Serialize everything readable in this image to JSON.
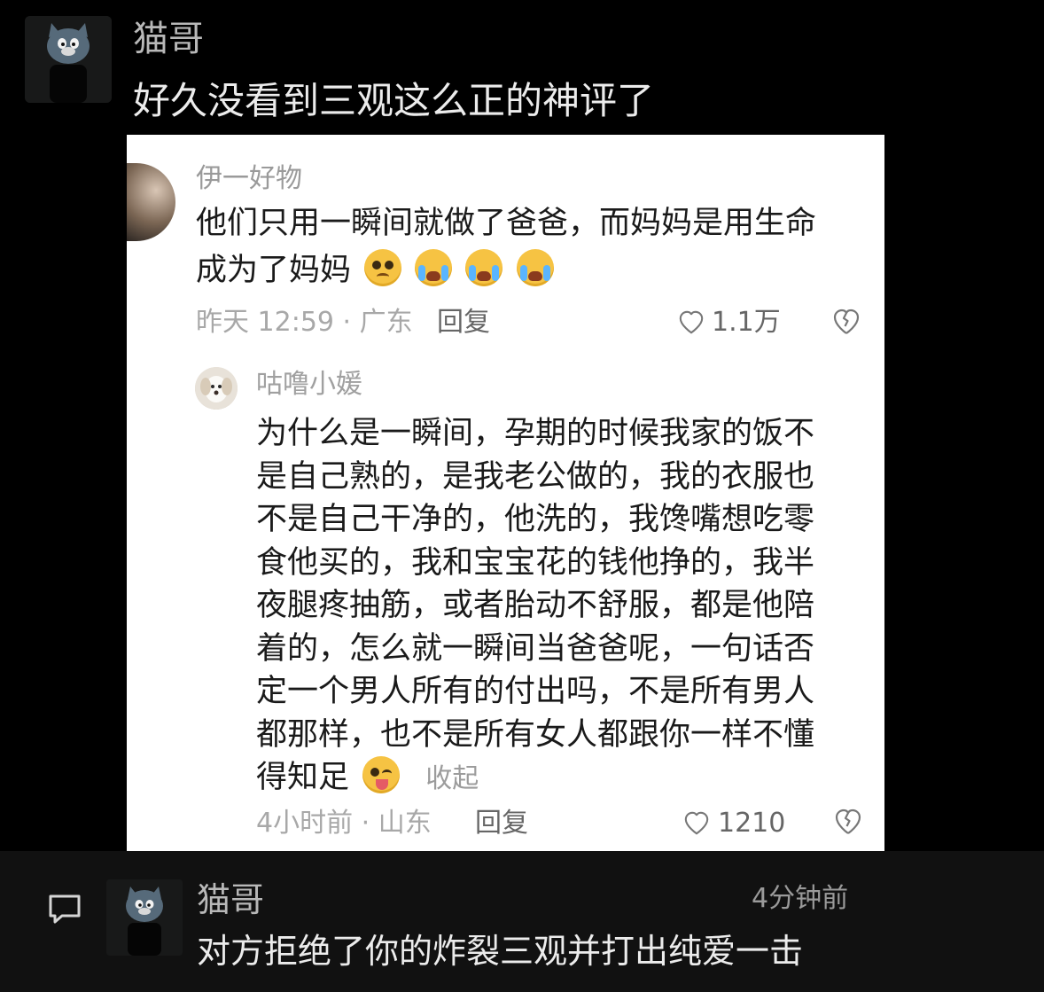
{
  "top_post": {
    "username": "猫哥",
    "text": "好久没看到三观这么正的神评了"
  },
  "card": {
    "main_comment": {
      "username": "伊一好物",
      "text_line1": "他们只用一瞬间就做了爸爸，而妈妈是用生命",
      "text_line2": "成为了妈妈",
      "emojis": [
        "worried-face-icon",
        "crying-face-icon",
        "crying-face-icon",
        "crying-face-icon"
      ],
      "meta": "昨天 12:59 · 广东",
      "reply_label": "回复",
      "likes": "1.1万"
    },
    "sub_comment": {
      "username": "咕噜小媛",
      "lines": [
        "为什么是一瞬间，孕期的时候我家的饭不",
        "是自己熟的，是我老公做的，我的衣服也",
        "不是自己干净的，他洗的，我馋嘴想吃零",
        "食他买的，我和宝宝花的钱他挣的，我半",
        "夜腿疼抽筋，或者胎动不舒服，都是他陪",
        "着的，怎么就一瞬间当爸爸呢，一句话否",
        "定一个男人所有的付出吗，不是所有男人",
        "都那样，也不是所有女人都跟你一样不懂",
        "得知足"
      ],
      "emoji": "winking-tongue-face-icon",
      "collapse_label": "收起",
      "meta": "4小时前 · 山东",
      "reply_label": "回复",
      "likes": "1210"
    }
  },
  "bottom_reply": {
    "username": "猫哥",
    "time": "4分钟前",
    "text": "对方拒绝了你的炸裂三观并打出纯爱一击"
  }
}
